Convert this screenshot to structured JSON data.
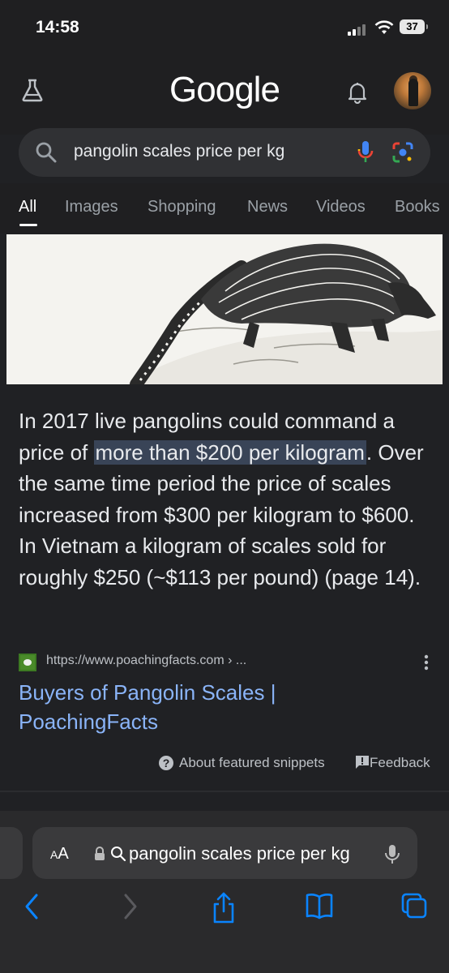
{
  "status_bar": {
    "time": "14:58",
    "battery": "37"
  },
  "header": {
    "logo": "Google"
  },
  "search": {
    "query": "pangolin scales price per kg"
  },
  "tabs": [
    {
      "label": "All",
      "active": true
    },
    {
      "label": "Images"
    },
    {
      "label": "Shopping"
    },
    {
      "label": "News"
    },
    {
      "label": "Videos"
    },
    {
      "label": "Books"
    }
  ],
  "snippet": {
    "before": "In 2017 live pangolins could command a price of ",
    "highlight": "more than $200 per kilogram",
    "after": ". Over the same time period the price of scales increased from $300 per kilogram to $600. In Vietnam a kilogram of scales sold for roughly $250 (~$113 per pound) (page 14)."
  },
  "source": {
    "url": "https://www.poachingfacts.com › ...",
    "title": "Buyers of Pangolin Scales | PoachingFacts"
  },
  "footer": {
    "about": "About featured snippets",
    "feedback": "Feedback"
  },
  "safari": {
    "aa_big": "A",
    "aa_small": "A",
    "address": "pangolin scales price per kg"
  },
  "colors": {
    "background": "#202124",
    "link": "#8ab4f8",
    "highlight": "#394457",
    "safari_blue": "#0a84ff"
  }
}
